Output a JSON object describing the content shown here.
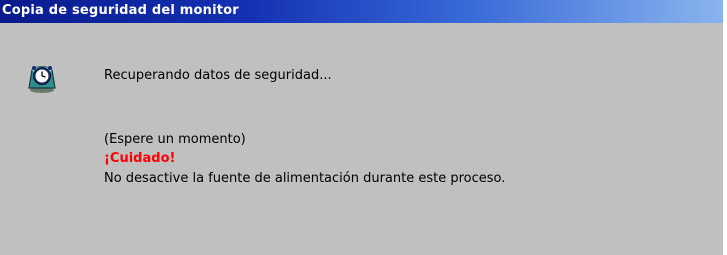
{
  "window": {
    "title": "Copia de seguridad del monitor"
  },
  "dialog": {
    "icon": "monitor-backup-clock-icon",
    "status_text": "Recuperando datos de seguridad...",
    "wait_text": "(Espere un momento)",
    "warning_title": "¡Cuidado!",
    "warning_text": "No desactive la fuente de alimentación durante este proceso."
  },
  "colors": {
    "window_bg": "#c0c0c0",
    "titlebar_start": "#0a1a8c",
    "titlebar_end": "#8ab4ee",
    "title_text": "#ffffff",
    "warning": "#ff0000"
  }
}
